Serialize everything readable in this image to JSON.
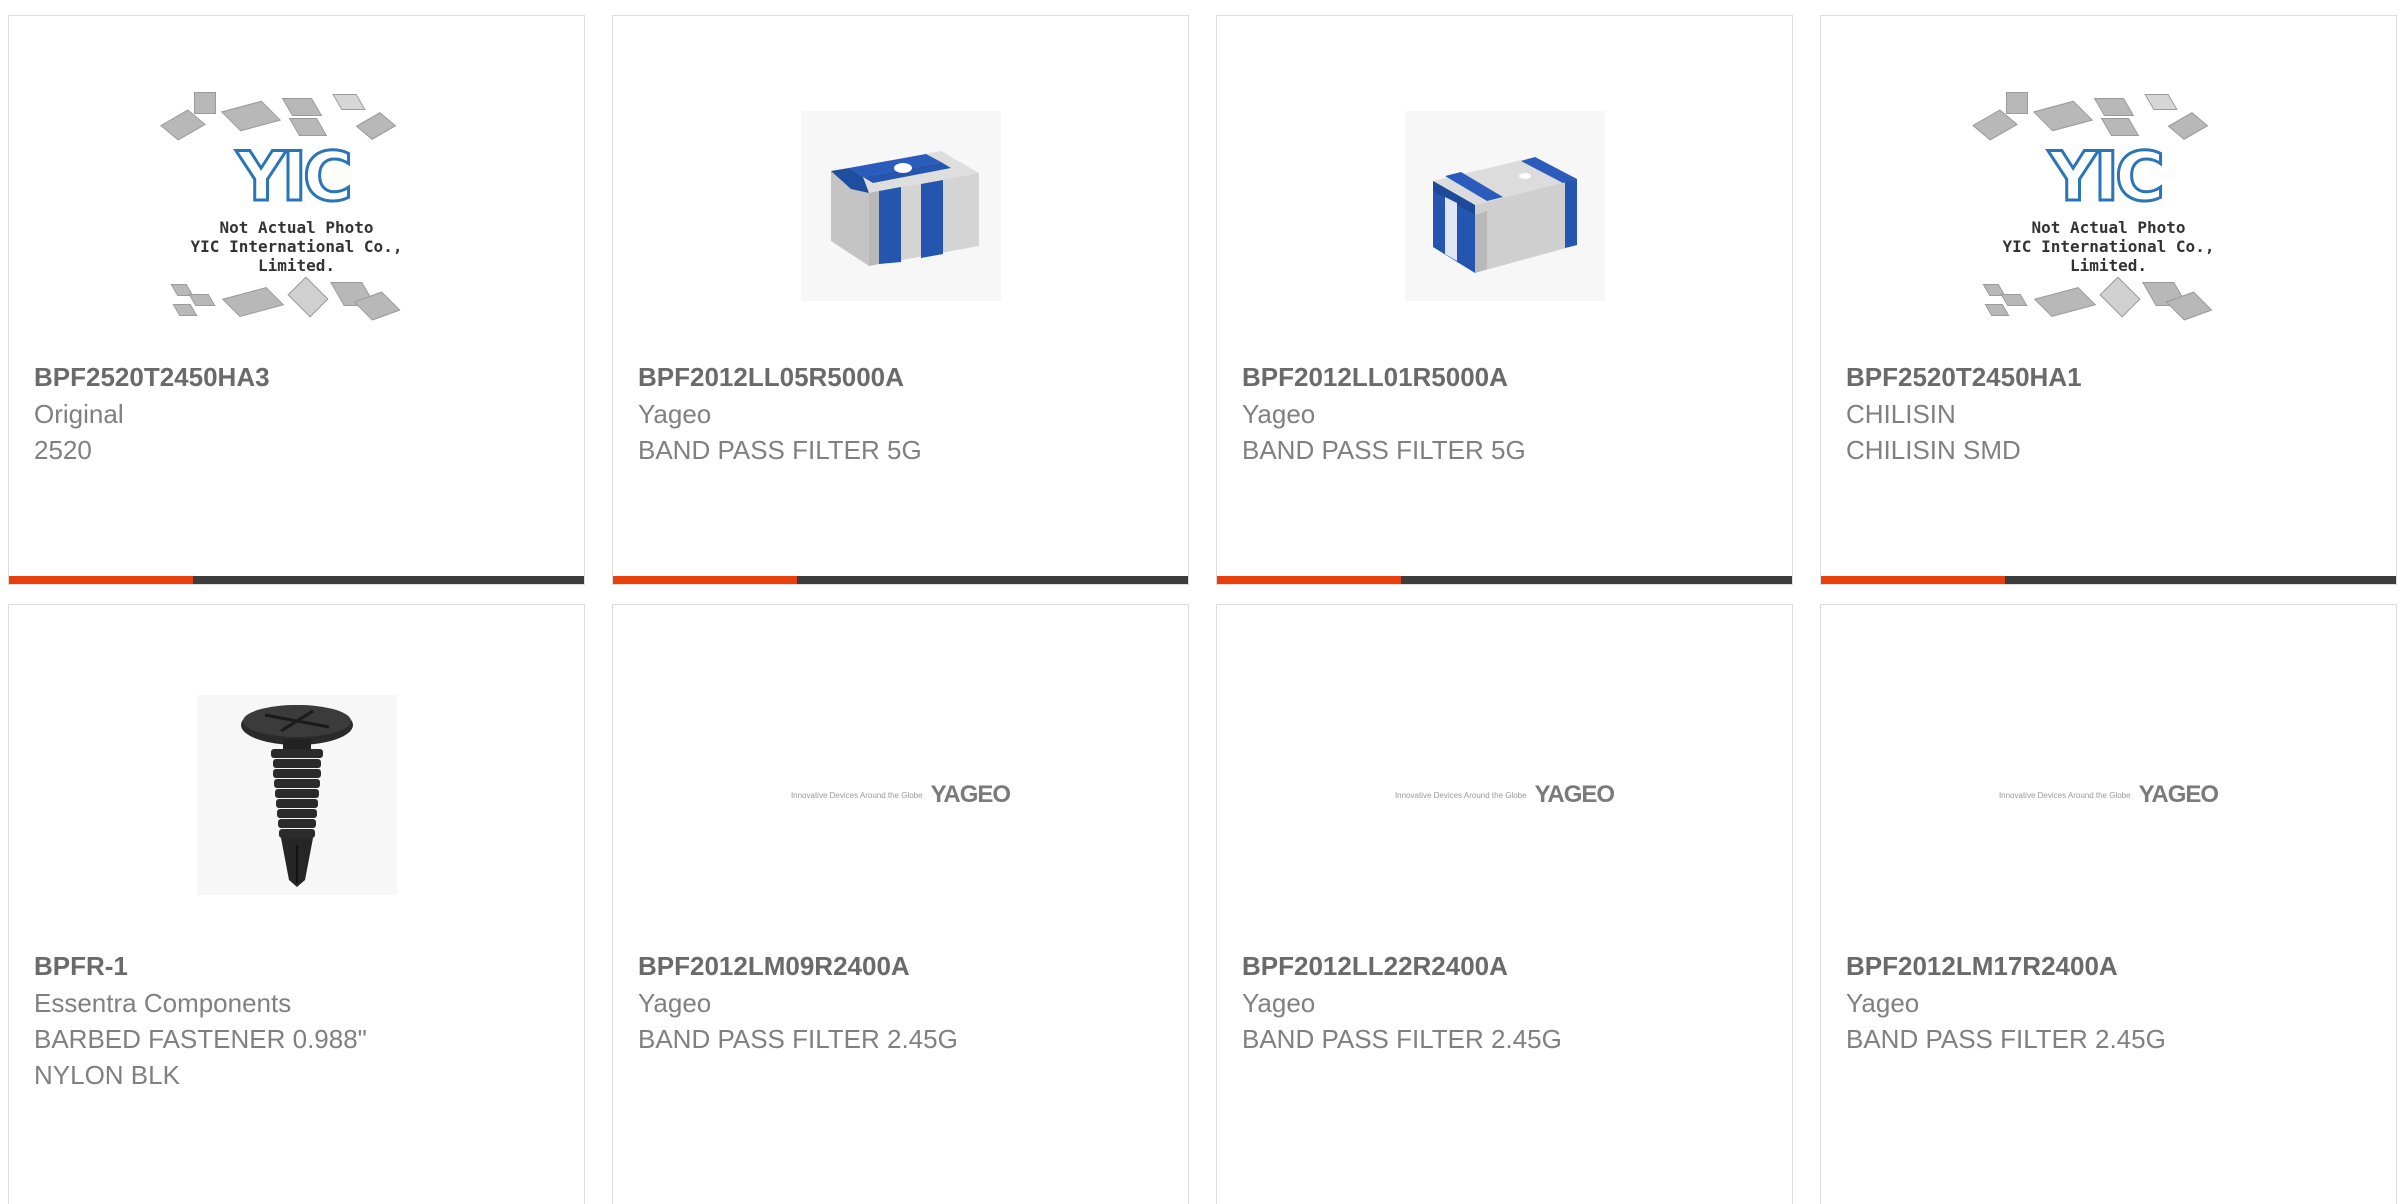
{
  "products": [
    {
      "part_number": "BPF2520T2450HA3",
      "manufacturer": "Original",
      "description": "2520",
      "image": "yic-placeholder",
      "image_caption": [
        "Not Actual Photo",
        "YIC International Co., Limited."
      ],
      "logo_text": "YIC"
    },
    {
      "part_number": "BPF2012LL05R5000A",
      "manufacturer": "Yageo",
      "description": "BAND PASS FILTER 5G",
      "image": "smd-chip-filter"
    },
    {
      "part_number": "BPF2012LL01R5000A",
      "manufacturer": "Yageo",
      "description": "BAND PASS FILTER 5G",
      "image": "smd-chip-filter"
    },
    {
      "part_number": "BPF2520T2450HA1",
      "manufacturer": "CHILISIN",
      "description": "CHILISIN SMD",
      "image": "yic-placeholder",
      "image_caption": [
        "Not Actual Photo",
        "YIC International Co., Limited."
      ],
      "logo_text": "YIC"
    },
    {
      "part_number": "BPFR-1",
      "manufacturer": "Essentra Components",
      "description": "BARBED FASTENER 0.988\"\nNYLON BLK",
      "image": "barbed-fastener"
    },
    {
      "part_number": "BPF2012LM09R2400A",
      "manufacturer": "Yageo",
      "description": "BAND PASS FILTER 2.45G",
      "image": "yageo-logo",
      "logo_text": "YAGEO",
      "logo_tagline": "Innovative Devices Around the Globe"
    },
    {
      "part_number": "BPF2012LL22R2400A",
      "manufacturer": "Yageo",
      "description": "BAND PASS FILTER 2.45G",
      "image": "yageo-logo",
      "logo_text": "YAGEO",
      "logo_tagline": "Innovative Devices Around the Globe"
    },
    {
      "part_number": "BPF2012LM17R2400A",
      "manufacturer": "Yageo",
      "description": "BAND PASS FILTER 2.45G",
      "image": "yageo-logo",
      "logo_text": "YAGEO",
      "logo_tagline": "Innovative Devices Around the Globe"
    }
  ],
  "colors": {
    "accent": "#e8400c",
    "bar_dark": "#3c3c3c",
    "card_border": "#dcdcdc",
    "part_number_text": "#6a6a6a",
    "secondary_text": "#808080",
    "yic_logo_blue": "#2a74b8",
    "chip_blue": "#2456b0"
  }
}
